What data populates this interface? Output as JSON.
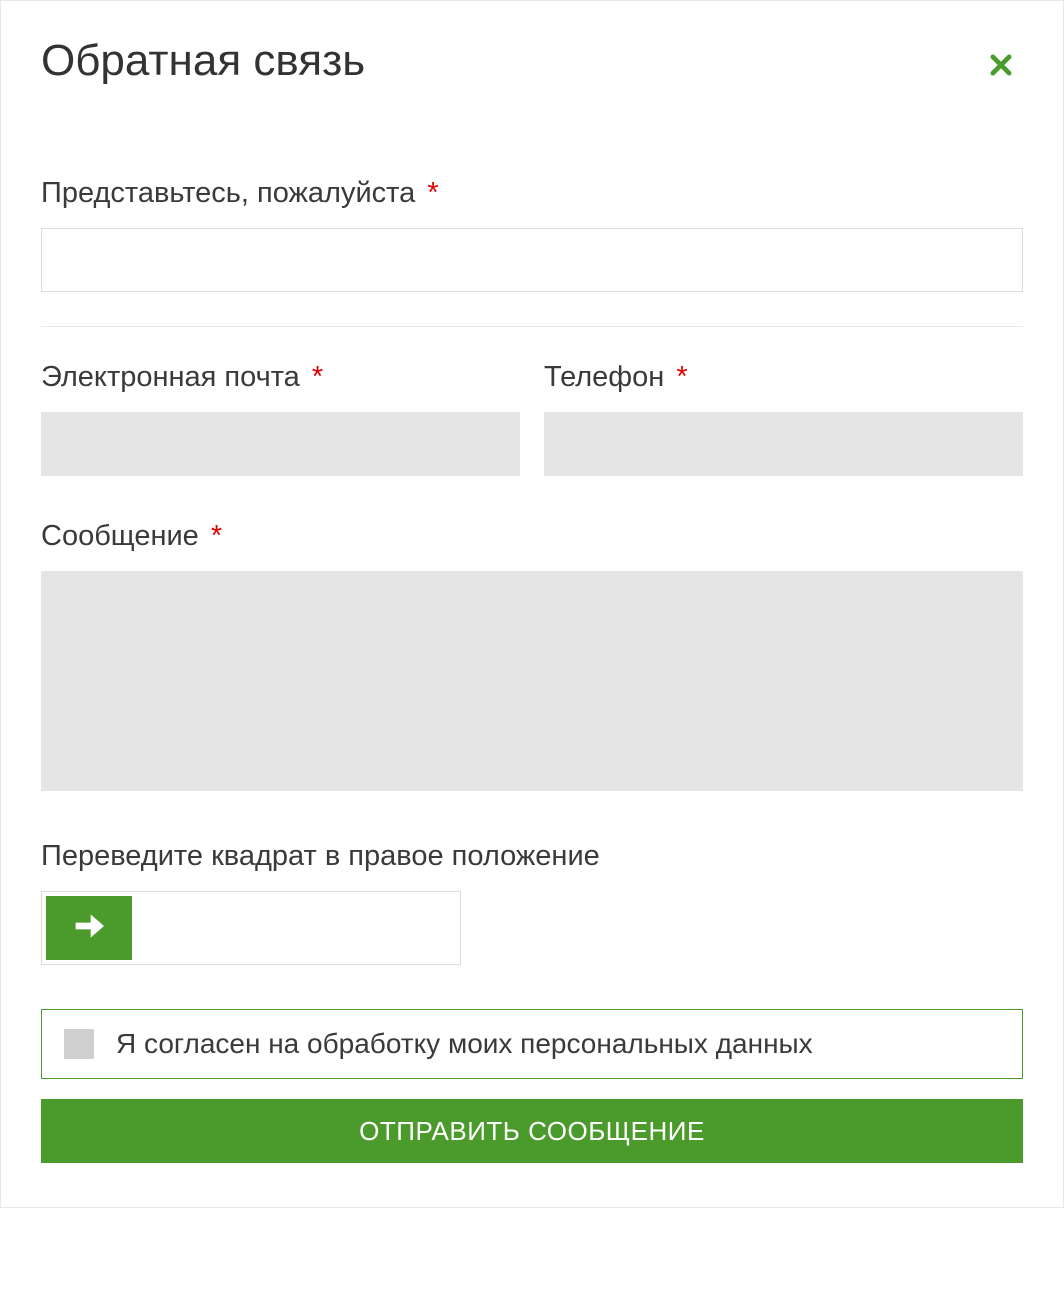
{
  "modal": {
    "title": "Обратная связь"
  },
  "form": {
    "name": {
      "label": "Представьтесь, пожалуйста",
      "required_mark": "*",
      "value": ""
    },
    "email": {
      "label": "Электронная почта",
      "required_mark": "*",
      "value": ""
    },
    "phone": {
      "label": "Телефон",
      "required_mark": "*",
      "value": ""
    },
    "message": {
      "label": "Сообщение",
      "required_mark": "*",
      "value": ""
    },
    "captcha": {
      "label": "Переведите квадрат в правое положение"
    },
    "consent": {
      "text": "Я согласен на обработку моих персональных данных",
      "checked": false
    },
    "submit_label": "ОТПРАВИТЬ СООБЩЕНИЕ"
  }
}
